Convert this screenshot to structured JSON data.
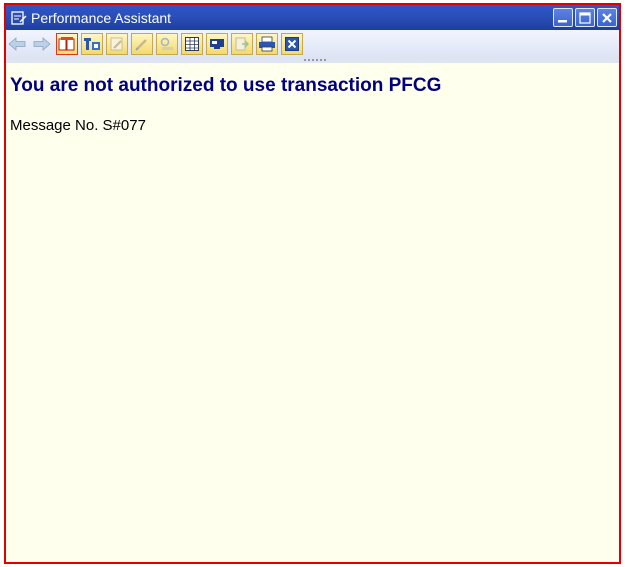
{
  "window": {
    "title": "Performance Assistant",
    "frame_color": "#e00000",
    "background_color": "#ffffee",
    "titlebar_color": "#2a4fb8"
  },
  "window_controls": [
    "minimize-icon",
    "maximize-icon",
    "close-icon"
  ],
  "toolbar": {
    "buttons": [
      {
        "icon": "back-arrow-icon",
        "enabled": false
      },
      {
        "icon": "forward-arrow-icon",
        "enabled": false
      },
      {
        "icon": "document-link-icon",
        "enabled": true,
        "selected": true
      },
      {
        "icon": "technical-info-icon",
        "enabled": true
      },
      {
        "icon": "edit-icon",
        "enabled": false
      },
      {
        "icon": "edit-pen-icon",
        "enabled": false
      },
      {
        "icon": "find-icon",
        "enabled": false
      },
      {
        "icon": "table-icon",
        "enabled": true
      },
      {
        "icon": "screen-icon",
        "enabled": true
      },
      {
        "icon": "export-icon",
        "enabled": false
      },
      {
        "icon": "print-icon",
        "enabled": true
      },
      {
        "icon": "close-window-icon",
        "enabled": true
      }
    ]
  },
  "content": {
    "heading": "You are not authorized to use transaction PFCG",
    "message": "Message No. S#077"
  }
}
